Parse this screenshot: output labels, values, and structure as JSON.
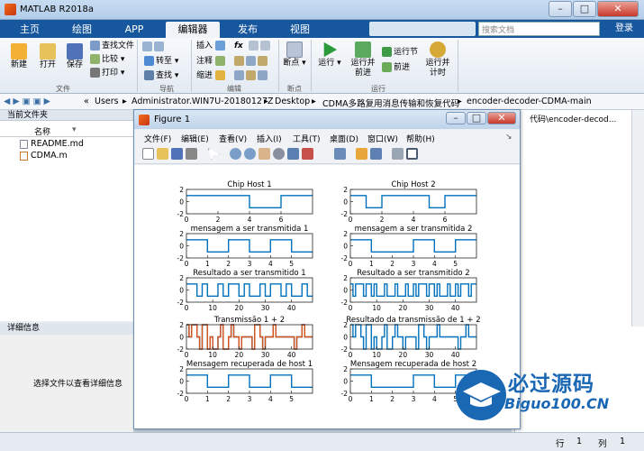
{
  "window": {
    "title": "MATLAB R2018a",
    "minimize": "–",
    "maximize": "□",
    "close": "✕"
  },
  "tabs": [
    {
      "label": "主页",
      "active": false
    },
    {
      "label": "绘图",
      "active": false
    },
    {
      "label": "APP",
      "active": false
    },
    {
      "label": "编辑器",
      "active": true
    },
    {
      "label": "发布",
      "active": false
    },
    {
      "label": "视图",
      "active": false
    }
  ],
  "search": {
    "placeholder": "搜索文档"
  },
  "login": "登录",
  "ribbon": {
    "file": {
      "new": "新建",
      "open": "打开",
      "save": "保存",
      "find_files": "查找文件",
      "compare": "比较",
      "print": "打印",
      "section": "文件"
    },
    "navigate": {
      "goto": "转至",
      "find": "查找",
      "section": "导航"
    },
    "edit": {
      "insert": "插入",
      "comment": "注释",
      "indent": "缩进",
      "fx": "fx",
      "section": "编辑"
    },
    "breakpoints": {
      "breakpoints": "断点",
      "section": "断点"
    },
    "run": {
      "run": "运行",
      "run_advance": "运行并\n前进",
      "run_section": "运行节",
      "advance": "前进",
      "run_time": "运行并\n计时",
      "section": "运行"
    }
  },
  "address": {
    "crumbs": [
      "Users",
      "Administrator.WIN7U-20180127Z",
      "Desktop",
      "CDMA多路复用消息传输和恢复代码",
      "encoder-decoder-CDMA-main"
    ]
  },
  "left_panel": {
    "title": "当前文件夹",
    "column": "名称",
    "files": [
      "README.md",
      "CDMA.m"
    ],
    "detail_title": "详细信息",
    "detail_hint": "选择文件以查看详细信息"
  },
  "right_panel": {
    "path_snippet": "代码\\encoder-decod..."
  },
  "status": {
    "row_label": "行",
    "row": "1",
    "col_label": "列",
    "col": "1"
  },
  "figure": {
    "title": "Figure 1",
    "menu": [
      "文件(F)",
      "编辑(E)",
      "查看(V)",
      "插入(I)",
      "工具(T)",
      "桌面(D)",
      "窗口(W)",
      "帮助(H)"
    ]
  },
  "chart_data": [
    {
      "type": "line",
      "title": "Chip Host 1",
      "x_ticks": [
        0,
        2,
        4,
        6
      ],
      "y_ticks": [
        -2,
        0,
        2
      ],
      "xlim": [
        0,
        8
      ],
      "ylim": [
        -2,
        2
      ],
      "series": [
        {
          "color": "#0072bd",
          "steps": [
            1,
            1,
            1,
            1,
            -1,
            -1,
            1,
            1
          ]
        }
      ]
    },
    {
      "type": "line",
      "title": "Chip Host 2",
      "x_ticks": [
        0,
        2,
        4,
        6
      ],
      "y_ticks": [
        -2,
        0,
        2
      ],
      "xlim": [
        0,
        8
      ],
      "ylim": [
        -2,
        2
      ],
      "series": [
        {
          "color": "#0072bd",
          "steps": [
            1,
            -1,
            1,
            1,
            1,
            -1,
            1,
            1
          ]
        }
      ]
    },
    {
      "type": "line",
      "title": "mensagem a ser transmitida 1",
      "x_ticks": [
        0,
        1,
        2,
        3,
        4,
        5
      ],
      "y_ticks": [
        -2,
        0,
        2
      ],
      "xlim": [
        0,
        6
      ],
      "ylim": [
        -2,
        2
      ],
      "series": [
        {
          "color": "#0072bd",
          "steps": [
            1,
            -1,
            1,
            -1,
            1,
            -1
          ]
        }
      ]
    },
    {
      "type": "line",
      "title": "mensagem a ser transmitida 2",
      "x_ticks": [
        0,
        1,
        2,
        3,
        4,
        5
      ],
      "y_ticks": [
        -2,
        0,
        2
      ],
      "xlim": [
        0,
        6
      ],
      "ylim": [
        -2,
        2
      ],
      "series": [
        {
          "color": "#0072bd",
          "steps": [
            1,
            -1,
            -1,
            1,
            -1,
            1
          ]
        }
      ]
    },
    {
      "type": "line",
      "title": "Resultado a ser transmitido 1",
      "x_ticks": [
        0,
        10,
        20,
        30,
        40
      ],
      "y_ticks": [
        -2,
        0,
        2
      ],
      "xlim": [
        0,
        48
      ],
      "ylim": [
        -2,
        2
      ],
      "series": [
        {
          "color": "#0072bd",
          "steps": [
            1,
            1,
            1,
            1,
            -1,
            -1,
            1,
            1,
            -1,
            -1,
            -1,
            -1,
            1,
            1,
            -1,
            -1,
            1,
            1,
            1,
            1,
            -1,
            -1,
            1,
            1,
            -1,
            -1,
            -1,
            -1,
            1,
            1,
            -1,
            -1,
            1,
            1,
            1,
            1,
            -1,
            -1,
            1,
            1,
            -1,
            -1,
            -1,
            -1,
            1,
            1,
            -1,
            -1
          ]
        }
      ]
    },
    {
      "type": "line",
      "title": "Resultado a ser transmitido 2",
      "x_ticks": [
        0,
        10,
        20,
        30,
        40
      ],
      "y_ticks": [
        -2,
        0,
        2
      ],
      "xlim": [
        0,
        48
      ],
      "ylim": [
        -2,
        2
      ],
      "series": [
        {
          "color": "#0072bd",
          "steps": [
            1,
            -1,
            1,
            1,
            1,
            -1,
            1,
            1,
            -1,
            1,
            -1,
            -1,
            -1,
            1,
            -1,
            -1,
            -1,
            1,
            -1,
            -1,
            -1,
            1,
            -1,
            -1,
            1,
            -1,
            1,
            1,
            1,
            -1,
            1,
            1,
            -1,
            1,
            -1,
            -1,
            -1,
            1,
            -1,
            -1,
            1,
            -1,
            1,
            1,
            1,
            -1,
            1,
            1
          ]
        }
      ]
    },
    {
      "type": "line",
      "title": "Transmissão 1 + 2",
      "x_ticks": [
        0,
        10,
        20,
        30,
        40
      ],
      "y_ticks": [
        -2,
        0,
        2
      ],
      "xlim": [
        0,
        48
      ],
      "ylim": [
        -2,
        2
      ],
      "series": [
        {
          "color": "#0072bd",
          "steps": [
            2,
            0,
            2,
            2,
            0,
            -2,
            2,
            2,
            -2,
            0,
            -2,
            -2,
            0,
            2,
            -2,
            -2,
            0,
            2,
            0,
            0,
            -2,
            0,
            0,
            0,
            0,
            -2,
            2,
            2,
            0,
            -2,
            0,
            0,
            0,
            2,
            0,
            0,
            0,
            0,
            0,
            0,
            0,
            -2,
            0,
            0,
            2,
            0,
            0,
            0
          ]
        },
        {
          "color": "#d95319",
          "steps": [
            2,
            0,
            2,
            2,
            0,
            -2,
            2,
            2,
            -2,
            0,
            -2,
            -2,
            0,
            2,
            -2,
            -2,
            0,
            2,
            0,
            0,
            -2,
            0,
            0,
            0,
            0,
            -2,
            2,
            2,
            0,
            -2,
            0,
            0,
            0,
            2,
            0,
            0,
            0,
            0,
            0,
            0,
            0,
            -2,
            0,
            0,
            2,
            0,
            0,
            0
          ]
        }
      ]
    },
    {
      "type": "line",
      "title": "Resultado da transmissão de 1 + 2",
      "x_ticks": [
        0,
        10,
        20,
        30,
        40
      ],
      "y_ticks": [
        -2,
        0,
        2
      ],
      "xlim": [
        0,
        48
      ],
      "ylim": [
        -2,
        2
      ],
      "series": [
        {
          "color": "#0072bd",
          "steps": [
            2,
            0,
            2,
            2,
            0,
            -2,
            2,
            2,
            -2,
            0,
            -2,
            -2,
            0,
            2,
            -2,
            -2,
            0,
            2,
            0,
            0,
            -2,
            0,
            0,
            0,
            0,
            -2,
            2,
            2,
            0,
            -2,
            0,
            0,
            0,
            2,
            0,
            0,
            0,
            0,
            0,
            0,
            0,
            -2,
            0,
            0,
            2,
            0,
            0,
            0
          ]
        }
      ]
    },
    {
      "type": "line",
      "title": "Mensagem recuperada de host 1",
      "x_ticks": [
        0,
        1,
        2,
        3,
        4,
        5
      ],
      "y_ticks": [
        -2,
        0,
        2
      ],
      "xlim": [
        0,
        6
      ],
      "ylim": [
        -2,
        2
      ],
      "series": [
        {
          "color": "#0072bd",
          "steps": [
            1,
            -1,
            1,
            -1,
            1,
            -1
          ]
        }
      ]
    },
    {
      "type": "line",
      "title": "Mensagem recuperada de host 2",
      "x_ticks": [
        0,
        1,
        2,
        3,
        4,
        5
      ],
      "y_ticks": [
        -2,
        0,
        2
      ],
      "xlim": [
        0,
        6
      ],
      "ylim": [
        -2,
        2
      ],
      "series": [
        {
          "color": "#0072bd",
          "steps": [
            1,
            -1,
            -1,
            1,
            -1,
            1
          ]
        }
      ]
    }
  ],
  "watermark": {
    "line1": "必过源码",
    "line2": "Biguo100.CN"
  }
}
